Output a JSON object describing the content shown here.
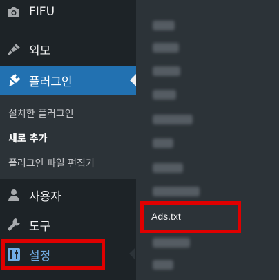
{
  "menu": {
    "fifu": {
      "label": "FIFU",
      "icon": "camera-icon"
    },
    "appearance": {
      "label": "외모",
      "icon": "paintbrush-icon"
    },
    "plugins": {
      "label": "플러그인",
      "icon": "plugin-icon",
      "submenu": {
        "installed": "설치한 플러그인",
        "add_new": "새로 추가",
        "file_editor": "플러그인 파일 편집기"
      }
    },
    "users": {
      "label": "사용자",
      "icon": "user-icon"
    },
    "tools": {
      "label": "도구",
      "icon": "wrench-icon"
    },
    "settings": {
      "label": "설정",
      "icon": "settings-sliders-icon"
    }
  },
  "flyout": {
    "highlighted_item": "Ads.txt"
  },
  "colors": {
    "sidebar_bg": "#1d2327",
    "submenu_bg": "#2c3338",
    "active_blue": "#2271b1",
    "highlight_red": "#e00000",
    "settings_text": "#72aee6"
  }
}
